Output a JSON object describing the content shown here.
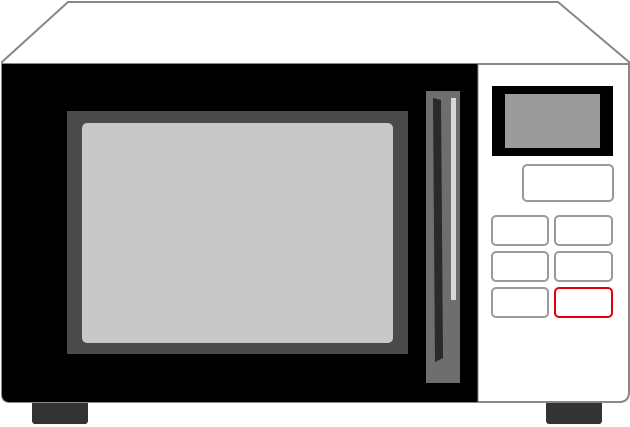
{
  "microwave": {
    "colors": {
      "body": "#ffffff",
      "outline": "#888888",
      "door": "#000000",
      "window_frame": "#4a4a4a",
      "window_glass": "#c8c8c8",
      "handle": "#6e6e6e",
      "display_bezel": "#000000",
      "display_screen": "#9b9b9b",
      "button_border": "#9a9a9a",
      "start_button_border": "#e0000a",
      "feet": "#333333"
    },
    "display": {
      "text": ""
    },
    "buttons": [
      {
        "id": "wide-button",
        "label": ""
      },
      {
        "id": "button-1",
        "label": ""
      },
      {
        "id": "button-2",
        "label": ""
      },
      {
        "id": "button-3",
        "label": ""
      },
      {
        "id": "button-4",
        "label": ""
      },
      {
        "id": "button-5",
        "label": ""
      },
      {
        "id": "start-button",
        "label": ""
      }
    ]
  }
}
